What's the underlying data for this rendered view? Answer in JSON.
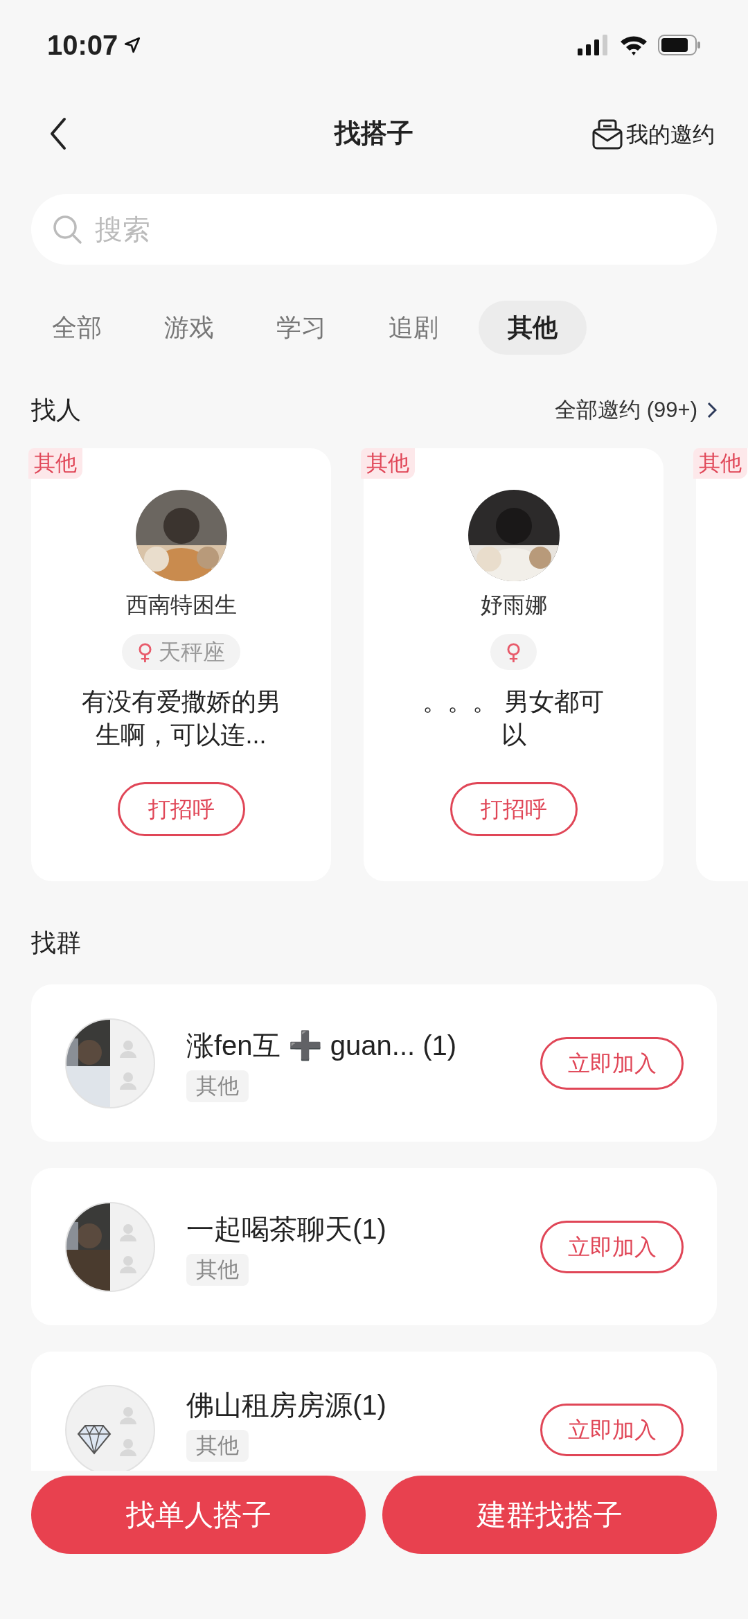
{
  "status_bar": {
    "time": "10:07"
  },
  "nav": {
    "title": "找搭子",
    "action": "我的邀约"
  },
  "search": {
    "placeholder": "搜索"
  },
  "tabs": [
    {
      "label": "全部",
      "selected": false
    },
    {
      "label": "游戏",
      "selected": false
    },
    {
      "label": "学习",
      "selected": false
    },
    {
      "label": "追剧",
      "selected": false
    },
    {
      "label": "其他",
      "selected": true
    }
  ],
  "people": {
    "title": "找人",
    "more": "全部邀约 (99+)",
    "cards": [
      {
        "tag": "其他",
        "name": "西南特困生",
        "gender": "♀",
        "sign": "天秤座",
        "text": "有没有爱撒娇的男生啊，可以连...",
        "button": "打招呼"
      },
      {
        "tag": "其他",
        "name": "妤雨娜",
        "gender": "♀",
        "text": "。。。 男女都可以",
        "button": "打招呼"
      },
      {
        "tag": "其他"
      }
    ]
  },
  "groups": {
    "title": "找群",
    "items": [
      {
        "name": "涨fen互 ➕ guan... (1)",
        "tag": "其他",
        "button": "立即加入"
      },
      {
        "name": "一起喝茶聊天(1)",
        "tag": "其他",
        "button": "立即加入"
      },
      {
        "name": "佛山租房房源(1)",
        "tag": "其他",
        "button": "立即加入",
        "kind": "diamond"
      }
    ]
  },
  "actions": [
    "找单人搭子",
    "建群找搭子"
  ]
}
